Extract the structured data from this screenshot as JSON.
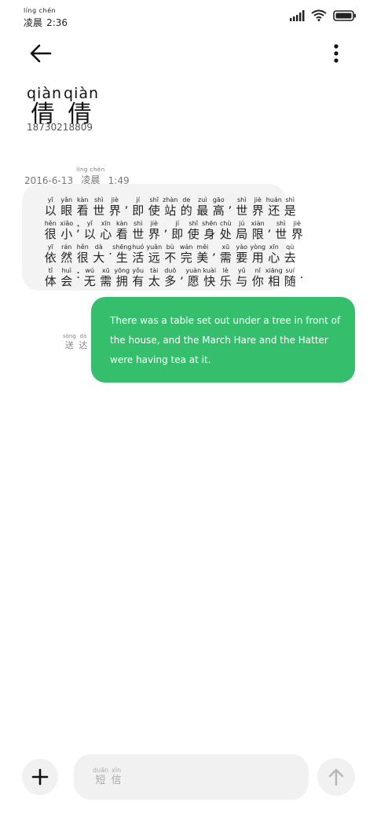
{
  "status_bar": {
    "time_ruby": "líng chén",
    "time_label": "凌晨",
    "time": "2:36",
    "icons": [
      "signal-icon",
      "wifi-icon",
      "battery-icon"
    ]
  },
  "header": {
    "icons": [
      "back-arrow-icon",
      "more-vertical-icon"
    ]
  },
  "contact": {
    "name_ruby": [
      "qiàn",
      "qiàn"
    ],
    "name": [
      "倩",
      "倩"
    ],
    "number": "18730218809"
  },
  "messages": {
    "timestamp": {
      "date": "2016-6-13",
      "period_ruby": "líng chén",
      "period": "凌晨",
      "time": "1:49"
    },
    "incoming": {
      "lines": [
        [
          {
            "py": "yǐ",
            "hz": "以"
          },
          {
            "py": "yǎn",
            "hz": "眼"
          },
          {
            "py": "kàn",
            "hz": "看"
          },
          {
            "py": "shì",
            "hz": "世"
          },
          {
            "py": "jiè",
            "hz": "界"
          },
          {
            "py": "",
            "hz": ","
          },
          {
            "py": "jí",
            "hz": "即"
          },
          {
            "py": "shǐ",
            "hz": "使"
          },
          {
            "py": "zhàn",
            "hz": "站"
          },
          {
            "py": "de",
            "hz": "的"
          },
          {
            "py": "zuì",
            "hz": "最"
          },
          {
            "py": "gāo",
            "hz": "高"
          },
          {
            "py": "",
            "hz": ","
          },
          {
            "py": "shì",
            "hz": "世"
          },
          {
            "py": "jiè",
            "hz": "界"
          },
          {
            "py": "huán",
            "hz": "还"
          },
          {
            "py": "shì",
            "hz": "是"
          }
        ],
        [
          {
            "py": "hěn",
            "hz": "很"
          },
          {
            "py": "xiǎo",
            "hz": "小"
          },
          {
            "py": "",
            "hz": ";"
          },
          {
            "py": "yǐ",
            "hz": "以"
          },
          {
            "py": "xīn",
            "hz": "心"
          },
          {
            "py": "kàn",
            "hz": "看"
          },
          {
            "py": "shì",
            "hz": "世"
          },
          {
            "py": "jiè",
            "hz": "界"
          },
          {
            "py": "",
            "hz": ","
          },
          {
            "py": "jí",
            "hz": "即"
          },
          {
            "py": "shǐ",
            "hz": "使"
          },
          {
            "py": "shēn",
            "hz": "身"
          },
          {
            "py": "chù",
            "hz": "处"
          },
          {
            "py": "jú",
            "hz": "局"
          },
          {
            "py": "xiàn",
            "hz": "限"
          },
          {
            "py": "",
            "hz": ","
          },
          {
            "py": "shì",
            "hz": "世"
          },
          {
            "py": "jiè",
            "hz": "界"
          }
        ],
        [
          {
            "py": "yī",
            "hz": "依"
          },
          {
            "py": "rán",
            "hz": "然"
          },
          {
            "py": "hěn",
            "hz": "很"
          },
          {
            "py": "dà",
            "hz": "大"
          },
          {
            "py": "",
            "hz": "."
          },
          {
            "py": "shēng",
            "hz": "生"
          },
          {
            "py": "huó",
            "hz": "活"
          },
          {
            "py": "yuǎn",
            "hz": "远"
          },
          {
            "py": "bù",
            "hz": "不"
          },
          {
            "py": "wán",
            "hz": "完"
          },
          {
            "py": "měi",
            "hz": "美"
          },
          {
            "py": "",
            "hz": ","
          },
          {
            "py": "xū",
            "hz": "需"
          },
          {
            "py": "yào",
            "hz": "要"
          },
          {
            "py": "yòng",
            "hz": "用"
          },
          {
            "py": "xīn",
            "hz": "心"
          },
          {
            "py": "qù",
            "hz": "去"
          }
        ],
        [
          {
            "py": "tǐ",
            "hz": "体"
          },
          {
            "py": "huì",
            "hz": "会"
          },
          {
            "py": "",
            "hz": ":"
          },
          {
            "py": "wú",
            "hz": "无"
          },
          {
            "py": "xū",
            "hz": "需"
          },
          {
            "py": "yōng",
            "hz": "拥"
          },
          {
            "py": "yǒu",
            "hz": "有"
          },
          {
            "py": "tài",
            "hz": "太"
          },
          {
            "py": "duō",
            "hz": "多"
          },
          {
            "py": "",
            "hz": ","
          },
          {
            "py": "yuàn",
            "hz": "愿"
          },
          {
            "py": "kuài",
            "hz": "快"
          },
          {
            "py": "lè",
            "hz": "乐"
          },
          {
            "py": "yǔ",
            "hz": "与"
          },
          {
            "py": "nǐ",
            "hz": "你"
          },
          {
            "py": "xiāng",
            "hz": "相"
          },
          {
            "py": "suí",
            "hz": "随"
          },
          {
            "py": "",
            "hz": "."
          }
        ]
      ]
    },
    "outgoing": {
      "text": "There was a table set out under a tree in front of the house, and the March Hare and the Hatter were having tea at it.",
      "status_ruby": [
        "sòng",
        "dá"
      ],
      "status": [
        "送",
        "达"
      ]
    }
  },
  "composer": {
    "placeholder_ruby": [
      "duǎn",
      "xìn"
    ],
    "placeholder": [
      "短",
      "信"
    ],
    "icons": [
      "plus-icon",
      "send-arrow-icon"
    ]
  },
  "colors": {
    "outgoing_bubble": "#35bf6c",
    "incoming_bubble": "#f3f3f3",
    "input_bg": "#f1f1f1"
  }
}
